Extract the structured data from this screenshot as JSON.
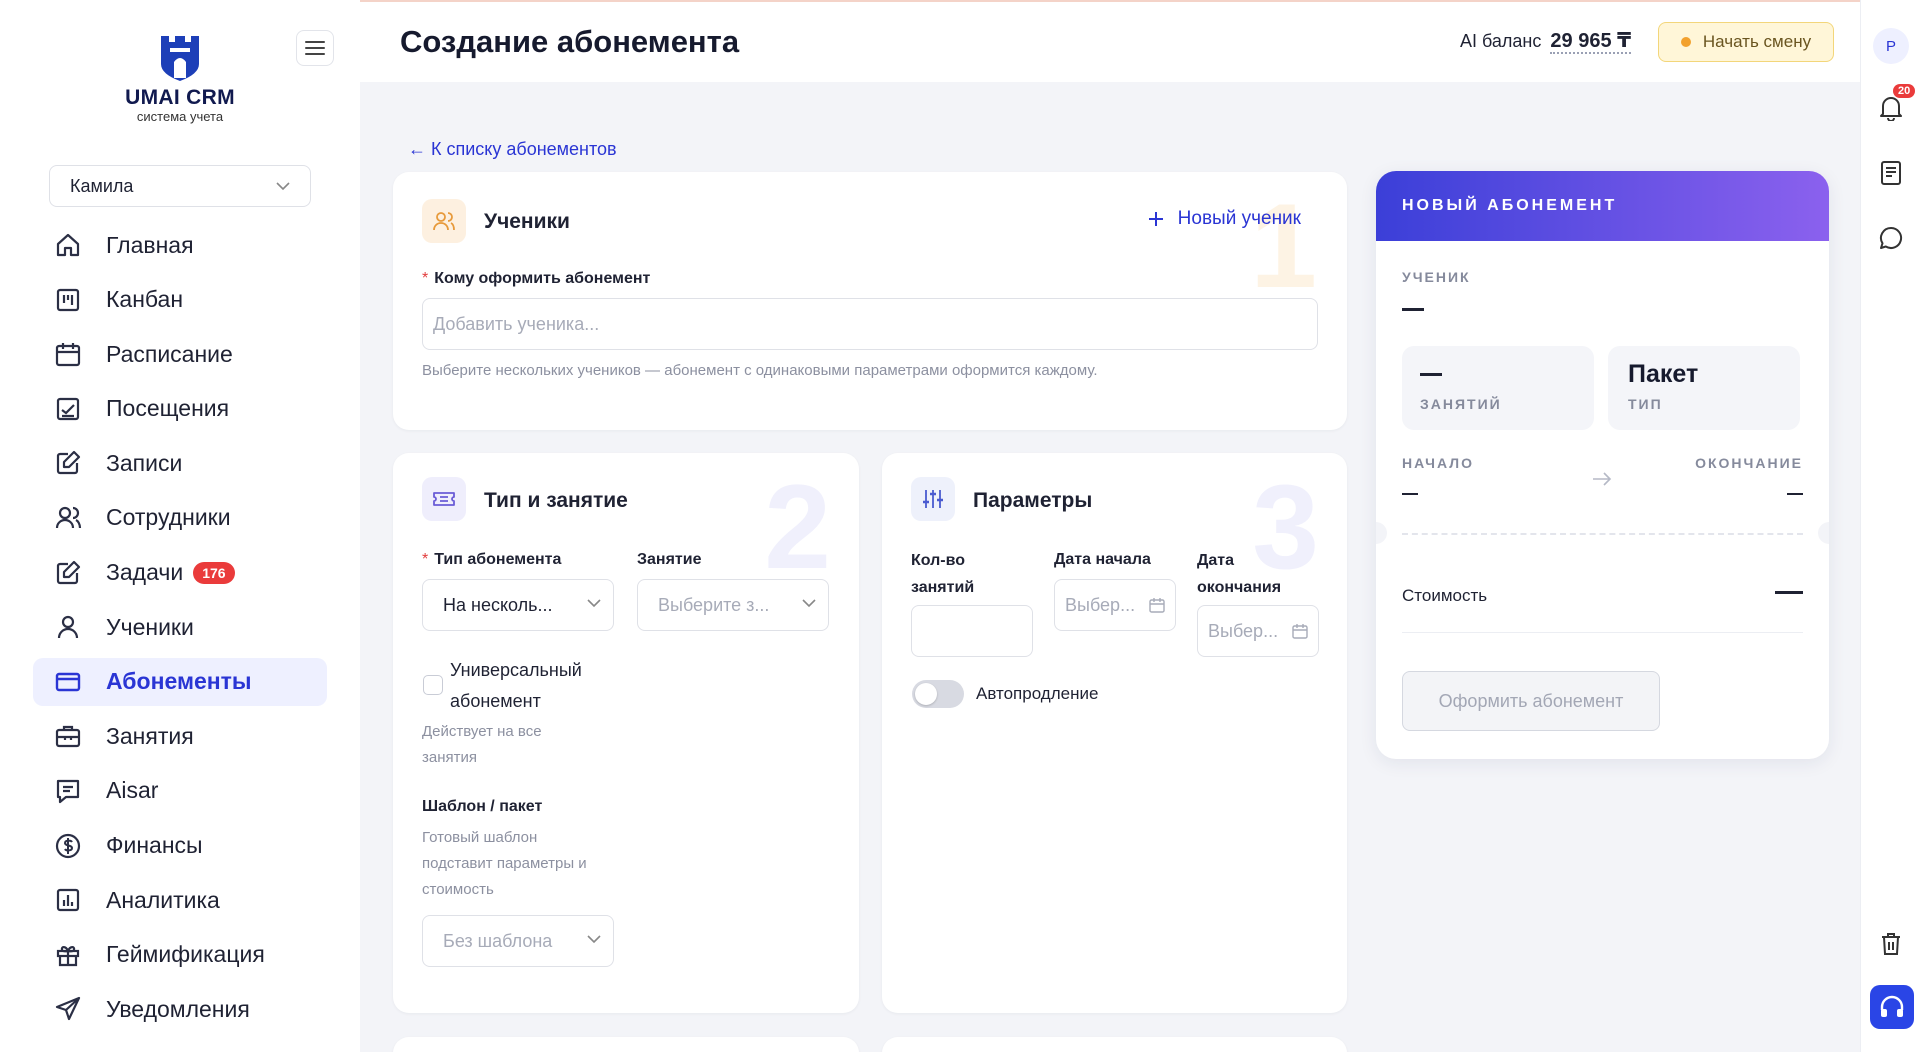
{
  "app": {
    "name": "UMAI CRM",
    "subtitle": "система учета"
  },
  "sidebar": {
    "user": "Камила",
    "items": [
      {
        "label": "Главная",
        "icon": "home-icon"
      },
      {
        "label": "Канбан",
        "icon": "kanban-icon"
      },
      {
        "label": "Расписание",
        "icon": "calendar-icon"
      },
      {
        "label": "Посещения",
        "icon": "attendance-icon"
      },
      {
        "label": "Записи",
        "icon": "edit-icon"
      },
      {
        "label": "Сотрудники",
        "icon": "users-icon"
      },
      {
        "label": "Задачи",
        "icon": "tasks-icon",
        "badge": "176"
      },
      {
        "label": "Ученики",
        "icon": "user-icon"
      },
      {
        "label": "Абонементы",
        "icon": "card-icon",
        "active": true
      },
      {
        "label": "Занятия",
        "icon": "briefcase-icon"
      },
      {
        "label": "Aisar",
        "icon": "chat-doc-icon"
      },
      {
        "label": "Финансы",
        "icon": "dollar-icon"
      },
      {
        "label": "Аналитика",
        "icon": "chart-icon"
      },
      {
        "label": "Геймификация",
        "icon": "gift-icon"
      },
      {
        "label": "Уведомления",
        "icon": "send-icon"
      }
    ]
  },
  "header": {
    "title": "Создание абонемента",
    "ai_label": "AI баланс",
    "ai_value": "29 965 ₸",
    "start_shift": "Начать смену"
  },
  "rail": {
    "avatar": "P",
    "notifications": "20"
  },
  "back_link": "← К списку абонементов",
  "students": {
    "step": "1",
    "title": "Ученики",
    "new_student": "Новый ученик",
    "field_label": "Кому оформить абонемент",
    "placeholder": "Добавить ученика...",
    "hint": "Выберите нескольких учеников — абонемент с одинаковыми параметрами оформится каждому."
  },
  "type": {
    "step": "2",
    "title": "Тип и занятие",
    "type_label": "Тип абонемента",
    "type_value": "На несколь...",
    "lesson_label": "Занятие",
    "lesson_placeholder": "Выберите з...",
    "universal_label_1": "Универсальный",
    "universal_label_2": "абонемент",
    "universal_hint_1": "Действует на все",
    "universal_hint_2": "занятия",
    "template_label": "Шаблон / пакет",
    "template_hint_1": "Готовый шаблон",
    "template_hint_2": "подставит параметры и",
    "template_hint_3": "стоимость",
    "template_value": "Без шаблона"
  },
  "params": {
    "step": "3",
    "title": "Параметры",
    "count_label_1": "Кол-во",
    "count_label_2": "занятий",
    "start_label": "Дата начала",
    "start_placeholder": "Выбер...",
    "end_label_1": "Дата",
    "end_label_2": "окончания",
    "end_placeholder": "Выбер...",
    "autorenew": "Автопродление"
  },
  "summary": {
    "header": "НОВЫЙ АБОНЕМЕНТ",
    "student_caption": "УЧЕНИК",
    "lessons_caption": "ЗАНЯТИЙ",
    "type_value": "Пакет",
    "type_caption": "ТИП",
    "start_caption": "НАЧАЛО",
    "end_caption": "ОКОНЧАНИЕ",
    "cost_label": "Стоимость",
    "order_button": "Оформить абонемент"
  },
  "colors": {
    "accent": "#2a35d4",
    "active_bg": "#eef0ff",
    "badge": "#ea3b3b",
    "gradient_start": "#3b3fd8",
    "gradient_end": "#8b61ee"
  }
}
